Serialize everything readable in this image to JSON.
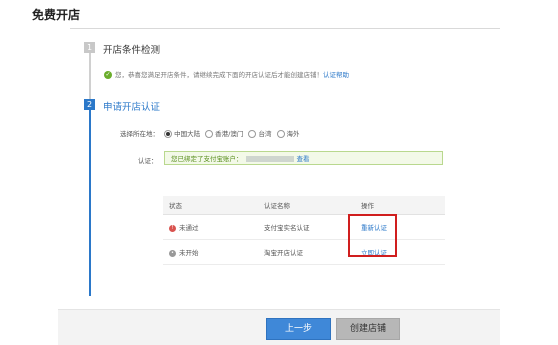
{
  "page_title": "免费开店",
  "steps": [
    {
      "number": "1",
      "title": "开店条件检测",
      "notice": "您，恭喜您满足开店条件，请继续完成下面的开店认证后才能创建店铺！",
      "notice_link": "认证帮助"
    },
    {
      "number": "2",
      "title": "申请开店认证",
      "region_label": "选择所在地：",
      "region_options": [
        "中国大陆",
        "香港/澳门",
        "台湾",
        "海外"
      ],
      "selected_region": "中国大陆",
      "auth_label": "认证：",
      "auth_text": "您已绑定了支付宝账户：",
      "auth_link": "查看"
    }
  ],
  "table": {
    "headers": [
      "状态",
      "认证名称",
      "操作"
    ],
    "rows": [
      {
        "status": "未通过",
        "status_type": "failed",
        "name": "支付宝实名认证",
        "action": "重新认证"
      },
      {
        "status": "未开始",
        "status_type": "pending",
        "name": "淘宝开店认证",
        "action": "立即认证"
      }
    ]
  },
  "buttons": {
    "prev": "上一步",
    "create": "创建店铺"
  },
  "colors": {
    "accent": "#2b78c9",
    "highlight": "#d01e1e",
    "success_green": "#6aad2b"
  }
}
